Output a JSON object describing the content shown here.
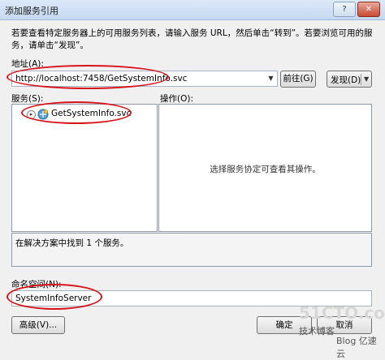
{
  "window": {
    "title": "添加服务引用",
    "help_button": "?",
    "close_button": "✕"
  },
  "description": "若要查看特定服务器上的可用服务列表，请输入服务 URL，然后单击“转到”。若要浏览可用的服务，请单击“发现”。",
  "address": {
    "label": "地址(A):",
    "value": "http://localhost:7458/GetSystemInfo.svc",
    "go_button": "前往(G)",
    "discover_button": "发现(D)"
  },
  "services": {
    "label": "服务(S):",
    "items": [
      {
        "expander": "▸",
        "icon": "service-icon",
        "label": "GetSystemInfo.svc"
      }
    ]
  },
  "operations": {
    "label": "操作(O):",
    "hint": "选择服务协定可查看其操作。"
  },
  "status": "在解决方案中找到 1 个服务。",
  "namespace": {
    "label": "命名空间(N):",
    "value": "SystemInfoServer"
  },
  "buttons": {
    "advanced": "高级(V)...",
    "ok": "确定",
    "cancel": "取消"
  },
  "watermark": {
    "line1": "51CTO.com",
    "line2": "技术博客",
    "line3": "Blog 亿速云"
  },
  "colors": {
    "highlight": "#d8141b"
  }
}
